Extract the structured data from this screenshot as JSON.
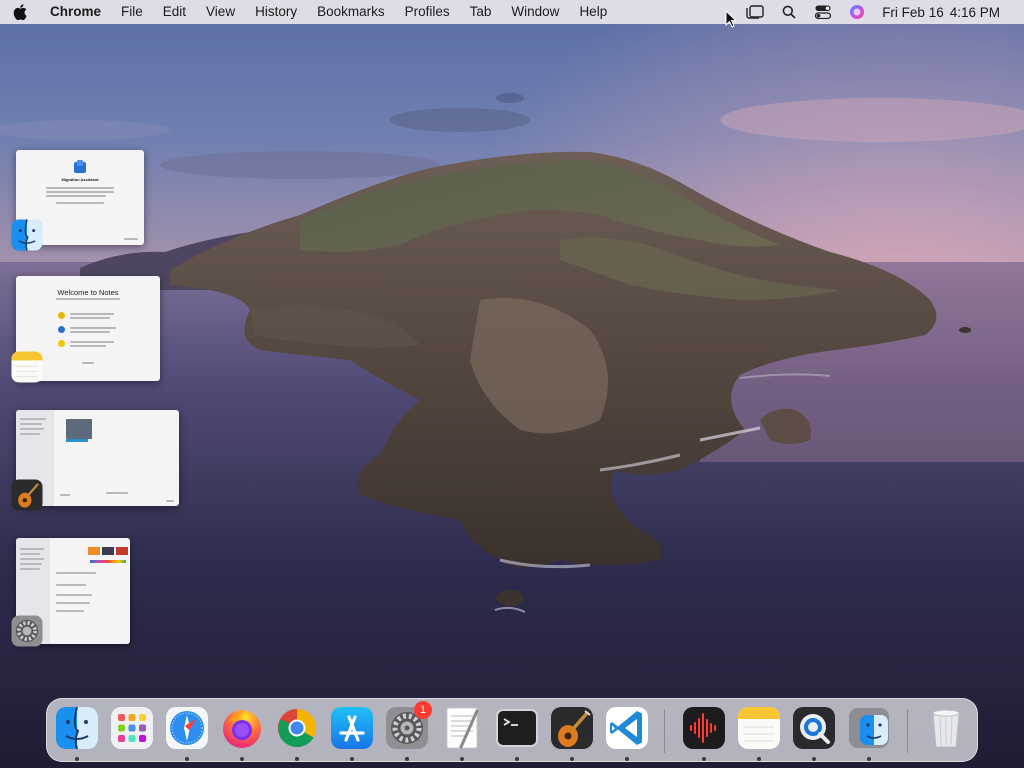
{
  "menubar": {
    "app_name": "Chrome",
    "menus": [
      "File",
      "Edit",
      "View",
      "History",
      "Bookmarks",
      "Profiles",
      "Tab",
      "Window",
      "Help"
    ],
    "status_icons": [
      "stage-manager-icon",
      "spotlight-search-icon",
      "control-center-icon",
      "siri-icon"
    ],
    "date": "Fri Feb 16",
    "time": "4:16 PM"
  },
  "stage_manager": {
    "windows": [
      {
        "app": "Finder",
        "app_icon": "finder-icon",
        "thumb_title": "Migration Assistant"
      },
      {
        "app": "Notes",
        "app_icon": "notes-icon",
        "thumb_title": "Welcome to Notes"
      },
      {
        "app": "GarageBand",
        "app_icon": "garageband-icon",
        "thumb_title": ""
      },
      {
        "app": "System Settings",
        "app_icon": "system-settings-icon",
        "thumb_title": ""
      }
    ]
  },
  "dock": {
    "apps": [
      {
        "name": "Finder",
        "icon": "finder-icon",
        "running": true
      },
      {
        "name": "Launchpad",
        "icon": "launchpad-icon",
        "running": false
      },
      {
        "name": "Safari",
        "icon": "safari-icon",
        "running": true
      },
      {
        "name": "Firefox",
        "icon": "firefox-icon",
        "running": true
      },
      {
        "name": "Google Chrome",
        "icon": "chrome-icon",
        "running": true
      },
      {
        "name": "App Store",
        "icon": "app-store-icon",
        "running": true
      },
      {
        "name": "System Settings",
        "icon": "system-settings-icon",
        "running": true,
        "badge": "1"
      },
      {
        "name": "TextEdit",
        "icon": "textedit-icon",
        "running": true
      },
      {
        "name": "Terminal",
        "icon": "terminal-icon",
        "running": true
      },
      {
        "name": "GarageBand",
        "icon": "garageband-icon",
        "running": true
      },
      {
        "name": "Visual Studio Code",
        "icon": "vscode-icon",
        "running": true
      },
      {
        "name": "Audio Recorder",
        "icon": "voice-memos-icon",
        "running": true
      },
      {
        "name": "Notes",
        "icon": "notes-icon",
        "running": true
      },
      {
        "name": "QuickTime Player",
        "icon": "quicktime-icon",
        "running": true
      },
      {
        "name": "Migration Assistant",
        "icon": "migration-assistant-icon",
        "running": true
      },
      {
        "name": "Trash",
        "icon": "trash-icon",
        "running": false
      }
    ]
  },
  "colors": {
    "menubar_bg": "#e8e4ec",
    "badge_red": "#ff3b30",
    "sky_top": "#5c6fa6",
    "sea": "#2b2a4a"
  }
}
